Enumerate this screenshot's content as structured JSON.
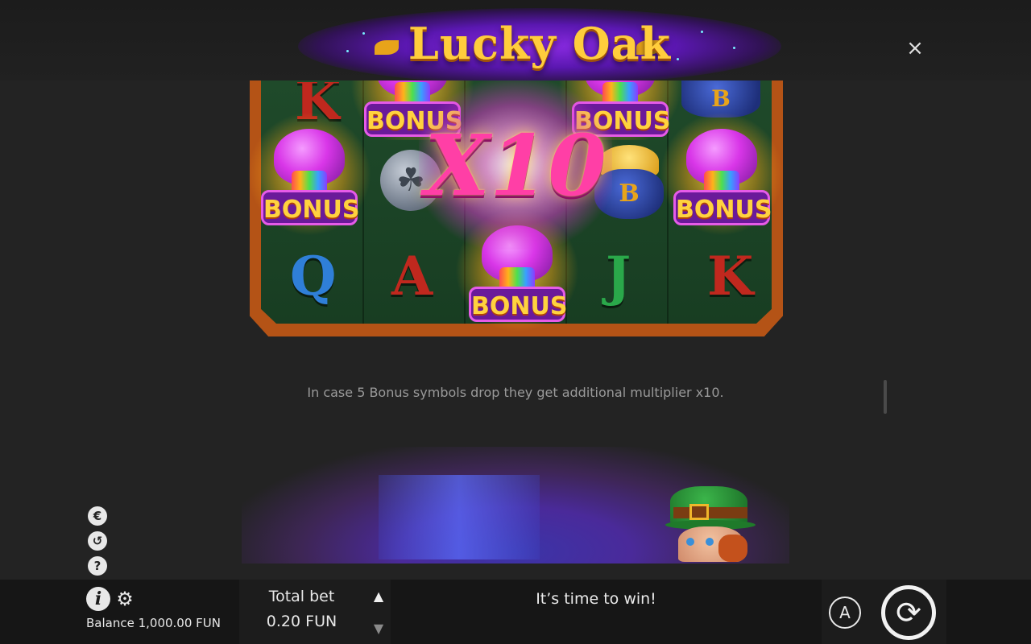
{
  "header": {
    "logo_text": "Lucky Oak",
    "close_icon": "close-icon",
    "close_glyph": "×"
  },
  "paytable": {
    "multiplier_text": "X10",
    "bonus_label": "BONUS",
    "symbols": {
      "q": "Q",
      "a": "A",
      "j": "J",
      "k": "K",
      "r": "K",
      "b_top": "B",
      "b_pot": "B"
    },
    "description": "In case 5 Bonus symbols drop they get additional multiplier x10."
  },
  "side_icons": [
    {
      "name": "bet-limits-icon",
      "glyph": "€"
    },
    {
      "name": "history-icon",
      "glyph": "↺"
    },
    {
      "name": "help-icon",
      "glyph": "?"
    }
  ],
  "bottom_bar": {
    "info_glyph": "i",
    "settings_glyph": "⚙",
    "balance_text": "Balance 1,000.00 FUN",
    "total_bet_label": "Total bet",
    "total_bet_value": "0.20 FUN",
    "bet_up_glyph": "▲",
    "bet_down_glyph": "▼",
    "message": "It’s time to win!",
    "autoplay_label": "A",
    "spin_glyph": "⟳"
  },
  "colors": {
    "background": "#232323",
    "bottom_bar": "#161616",
    "logo_gold": "#ffcd3c",
    "logo_purple": "#8a2be2",
    "board_frame": "#b45316",
    "board_felt": "#1f4a2a",
    "multiplier_pink": "#ff3fa6",
    "bonus_purple": "#6a1a9a",
    "description_text": "#9a9a9a"
  }
}
